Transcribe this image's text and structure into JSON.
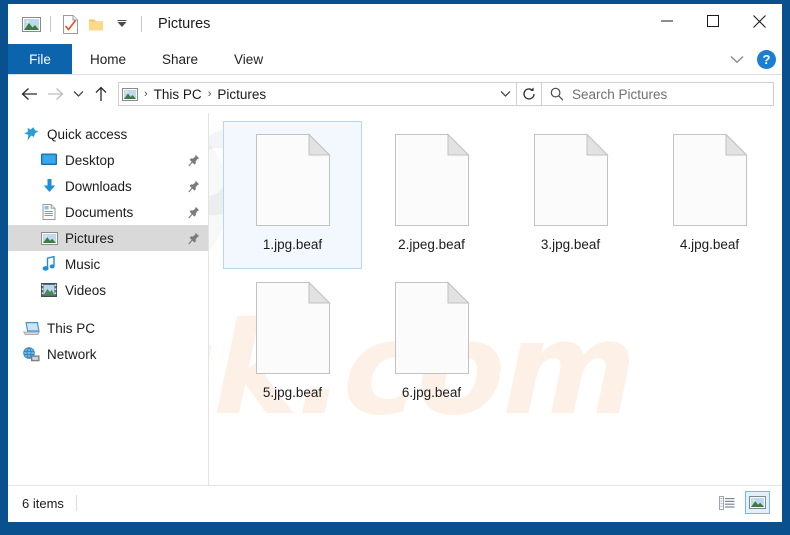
{
  "window": {
    "title": "Pictures",
    "frame_color": "#09508f",
    "quick_access_icons": [
      "picture-icon",
      "properties-icon",
      "new-folder-icon",
      "customize-chevron-icon"
    ],
    "controls": {
      "minimize": "—",
      "maximize": "□",
      "close": "✕"
    }
  },
  "ribbon": {
    "file_tab": "File",
    "tabs": [
      "Home",
      "Share",
      "View"
    ],
    "collapse_icon": "chevron-down-icon",
    "help_label": "?",
    "accent_color": "#0c64ad"
  },
  "address": {
    "back_icon": "back-arrow-icon",
    "forward_icon": "forward-arrow-icon",
    "recent_icon": "chevron-down-icon",
    "up_icon": "up-arrow-icon",
    "breadcrumb_icon": "picture-icon",
    "breadcrumbs": [
      "This PC",
      "Pictures"
    ],
    "separator": "›",
    "dropdown_icon": "chevron-down-icon",
    "refresh_icon": "refresh-icon"
  },
  "search": {
    "icon": "search-icon",
    "placeholder": "Search Pictures",
    "value": ""
  },
  "sidebar": {
    "items": [
      {
        "label": "Quick access",
        "icon": "star-icon",
        "level": 0,
        "pinned": false,
        "selected": false
      },
      {
        "label": "Desktop",
        "icon": "desktop-icon",
        "level": 1,
        "pinned": true,
        "selected": false
      },
      {
        "label": "Downloads",
        "icon": "download-icon",
        "level": 1,
        "pinned": true,
        "selected": false
      },
      {
        "label": "Documents",
        "icon": "document-icon",
        "level": 1,
        "pinned": true,
        "selected": false
      },
      {
        "label": "Pictures",
        "icon": "picture-icon",
        "level": 1,
        "pinned": true,
        "selected": true
      },
      {
        "label": "Music",
        "icon": "music-icon",
        "level": 1,
        "pinned": false,
        "selected": false
      },
      {
        "label": "Videos",
        "icon": "video-icon",
        "level": 1,
        "pinned": false,
        "selected": false
      },
      {
        "label": "This PC",
        "icon": "computer-icon",
        "level": 0,
        "pinned": false,
        "selected": false
      },
      {
        "label": "Network",
        "icon": "network-icon",
        "level": 0,
        "pinned": false,
        "selected": false
      }
    ]
  },
  "files": [
    {
      "name": "1.jpg.beaf",
      "icon": "blank-file-icon",
      "selected": true
    },
    {
      "name": "2.jpeg.beaf",
      "icon": "blank-file-icon",
      "selected": false
    },
    {
      "name": "3.jpg.beaf",
      "icon": "blank-file-icon",
      "selected": false
    },
    {
      "name": "4.jpg.beaf",
      "icon": "blank-file-icon",
      "selected": false
    },
    {
      "name": "5.jpg.beaf",
      "icon": "blank-file-icon",
      "selected": false
    },
    {
      "name": "6.jpg.beaf",
      "icon": "blank-file-icon",
      "selected": false
    }
  ],
  "status": {
    "item_count": "6 items",
    "details_view_icon": "details-view-icon",
    "large_icons_view_icon": "large-icons-view-icon",
    "active_view": "large-icons-view-icon"
  },
  "watermark": {
    "line1": "pc",
    "line2": "risk.com"
  }
}
